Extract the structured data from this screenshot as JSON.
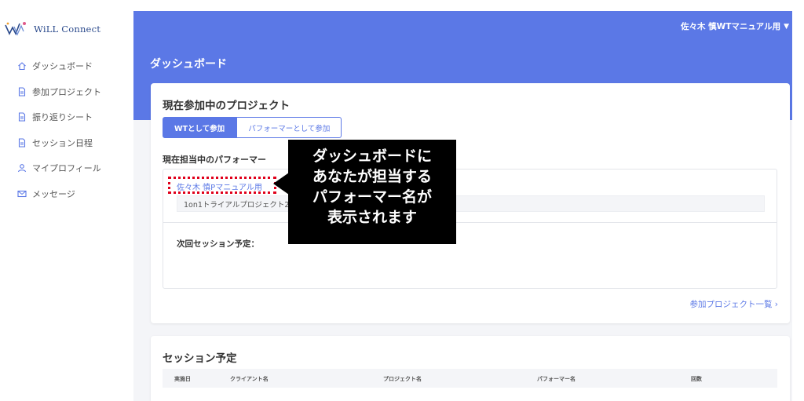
{
  "logo": {
    "text": "WiLL Connect"
  },
  "sidebar": {
    "items": [
      {
        "label": "ダッシュボード",
        "icon": "home-icon"
      },
      {
        "label": "参加プロジェクト",
        "icon": "document-icon"
      },
      {
        "label": "振り返りシート",
        "icon": "document-icon"
      },
      {
        "label": "セッション日程",
        "icon": "document-icon"
      },
      {
        "label": "マイプロフィール",
        "icon": "user-icon"
      },
      {
        "label": "メッセージ",
        "icon": "mail-icon"
      }
    ]
  },
  "header": {
    "user_name": "佐々木 慎WTマニュアル用",
    "page_title": "ダッシュボード"
  },
  "card": {
    "title": "現在参加中のプロジェクト",
    "tabs": [
      "WTとして参加",
      "パフォーマーとして参加"
    ],
    "section_label": "現在担当中のパフォーマー",
    "performer_name": "佐々木 慎Pマニュアル用",
    "project_name": "1on1トライアルプロジェクト20",
    "next_session_label": "次回セッション予定：",
    "project_list_link": "参加プロジェクト一覧 ›"
  },
  "session": {
    "title": "セッション予定",
    "columns": [
      "実施日",
      "クライアント名",
      "プロジェクト名",
      "パフォーマー名",
      "回数"
    ]
  },
  "annotation": {
    "lines": [
      "ダッシュボードに",
      "あなたが担当する",
      "パフォーマー名が",
      "表示されます"
    ]
  },
  "colors": {
    "accent": "#5b78e6",
    "highlight": "#e0001b",
    "callout_bg": "#000000"
  }
}
